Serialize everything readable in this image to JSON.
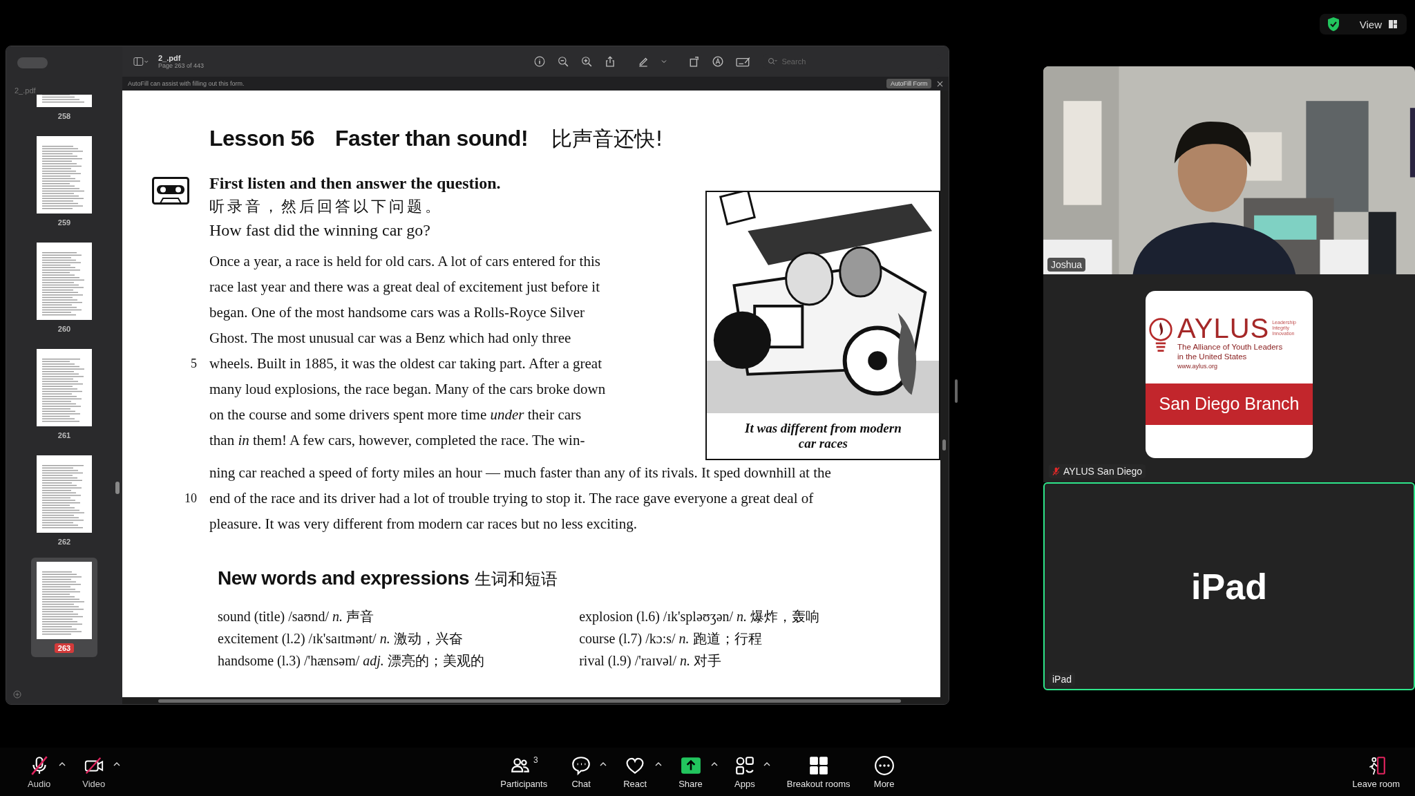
{
  "pdf_viewer": {
    "sidebar": {
      "title": "2_.pdf",
      "thumbnails": [
        {
          "page": "258",
          "selected": false
        },
        {
          "page": "259",
          "selected": false
        },
        {
          "page": "260",
          "selected": false
        },
        {
          "page": "261",
          "selected": false
        },
        {
          "page": "262",
          "selected": false
        },
        {
          "page": "263",
          "selected": true
        }
      ]
    },
    "toolbar": {
      "title": "2_.pdf",
      "subtitle": "Page 263 of 443",
      "search": {
        "placeholder": "Search"
      }
    },
    "autofill_bar": {
      "message": "AutoFill can assist with filling out this form.",
      "button": "AutoFill Form"
    },
    "page": {
      "lesson": "Lesson 56",
      "title": "Faster than sound!",
      "title_zh": "比声音还快!",
      "instruction": "First listen and then answer the question.",
      "instruction_zh": "听录音，然后回答以下问题。",
      "question": "How fast did the winning car go?",
      "lines_beside": [
        {
          "text": "Once a year, a race is held for old cars. A lot of cars entered for this"
        },
        {
          "text": "race last year and there was a great deal of excitement just before it"
        },
        {
          "text": "began. One of the most handsome cars was a Rolls-Royce Silver"
        },
        {
          "text": "Ghost. The most unusual car was a Benz which had only three"
        },
        {
          "number": "5",
          "text": "wheels. Built in 1885, it was the oldest car taking part. After a great"
        },
        {
          "text": "many loud explosions, the race began. Many of the cars broke down"
        },
        {
          "text": "on the course and some drivers spent more time *under* their cars"
        },
        {
          "text": "than *in* them! A few cars, however, completed the race. The win-"
        }
      ],
      "lines_below": [
        {
          "text": "ning car reached a speed of forty miles an hour — much faster than any of its rivals. It sped downhill at the"
        },
        {
          "number": "10",
          "text": "end of the race and its driver had a lot of trouble trying to stop it. The race gave everyone a great deal of"
        },
        {
          "text": "pleasure. It was very different from modern car races but no less exciting."
        }
      ],
      "caption_lines": [
        "It was different from modern",
        "car races"
      ],
      "section_title": "New words and expressions",
      "section_title_zh": "生词和短语",
      "vocab_left": [
        "sound (title) /saʊnd/ *n.* 声音",
        "excitement (l.2) /ɪk'saɪtmənt/ *n.* 激动，兴奋",
        "handsome (l.3) /'hænsəm/ *adj.* 漂亮的；美观的"
      ],
      "vocab_right": [
        "explosion (l.6) /ɪk'spləʊʒən/ *n.* 爆炸，轰响",
        "course (l.7) /kɔ:s/ *n.* 跑道；行程",
        "rival (l.9) /'raɪvəl/ *n.* 对手"
      ]
    }
  },
  "view_button": {
    "label": "View"
  },
  "tiles": [
    {
      "kind": "video",
      "name": "Joshua",
      "muted": false,
      "active": false
    },
    {
      "kind": "logo",
      "name": "AYLUS San Diego",
      "muted": true,
      "active": false,
      "logo": {
        "wordmark": "AYLUS",
        "motto": [
          "Leadership",
          "Integrity",
          "Innovation"
        ],
        "lines": [
          "The Alliance of Youth Leaders",
          "in the United States"
        ],
        "url": "www.aylus.org",
        "branch": "San Diego Branch"
      }
    },
    {
      "kind": "text",
      "name": "iPad",
      "text": "iPad",
      "muted": false,
      "active": true
    }
  ],
  "meeting_toolbar": [
    {
      "kind": "audio",
      "label": "Audio",
      "off": true,
      "menu": true
    },
    {
      "kind": "video",
      "label": "Video",
      "off": true,
      "menu": true
    },
    {
      "kind": "participants",
      "label": "Participants",
      "count": "3"
    },
    {
      "kind": "chat",
      "label": "Chat",
      "menu": true
    },
    {
      "kind": "react",
      "label": "React",
      "menu": true
    },
    {
      "kind": "share",
      "label": "Share",
      "menu": true
    },
    {
      "kind": "apps",
      "label": "Apps",
      "menu": true
    },
    {
      "kind": "breakout",
      "label": "Breakout rooms"
    },
    {
      "kind": "more",
      "label": "More"
    },
    {
      "kind": "leave",
      "label": "Leave room"
    }
  ]
}
